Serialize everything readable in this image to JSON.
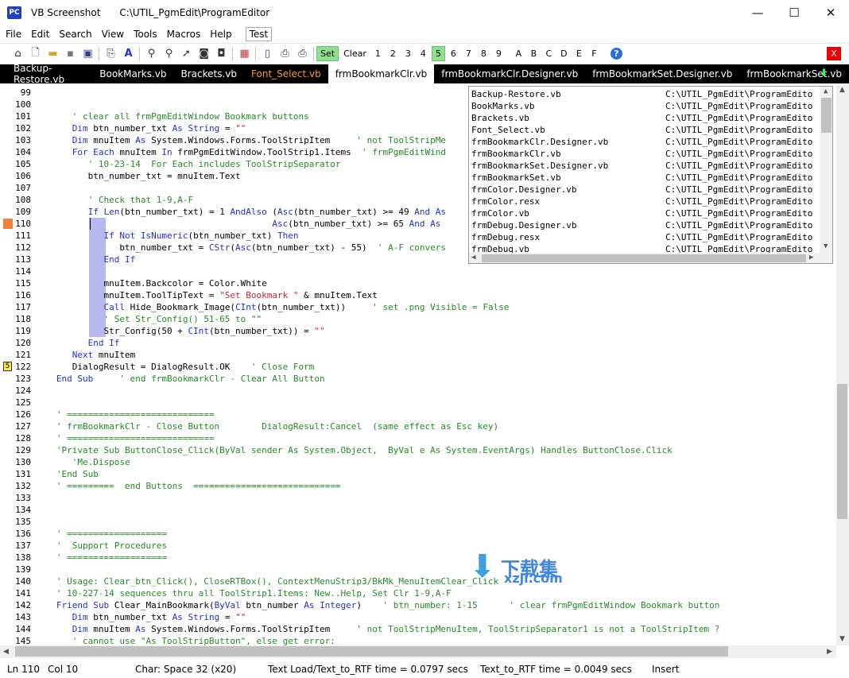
{
  "window": {
    "app_icon_text": "PC",
    "title": "VB Screenshot",
    "path": "C:\\UTIL_PgmEdit\\ProgramEditor",
    "minimize": "—",
    "maximize": "☐",
    "close": "✕"
  },
  "menu": [
    "File",
    "Edit",
    "Search",
    "View",
    "Tools",
    "Macros",
    "Help"
  ],
  "menu_test_box": "Test",
  "toolbar": {
    "icons": [
      "home-icon",
      "new-file-icon",
      "open-folder-icon",
      "save-icon",
      "save-all-icon",
      "copy-icon",
      "font-icon",
      "find-icon",
      "find-next-icon",
      "goto-icon",
      "replace-icon",
      "replace-all-icon",
      "color-grid-icon",
      "book-icon",
      "print-preview-icon",
      "print-icon"
    ],
    "set_label": "Set",
    "clear_label": "Clear",
    "numbers": [
      "1",
      "2",
      "3",
      "4",
      "5",
      "6",
      "7",
      "8",
      "9"
    ],
    "active_number": "5",
    "letters": [
      "A",
      "B",
      "C",
      "D",
      "E",
      "F"
    ],
    "help_icon": "?",
    "close_label": "X"
  },
  "tabs": [
    {
      "label": "Backup-Restore.vb",
      "state": "normal"
    },
    {
      "label": "BookMarks.vb",
      "state": "normal"
    },
    {
      "label": "Brackets.vb",
      "state": "normal"
    },
    {
      "label": "Font_Select.vb",
      "state": "orange"
    },
    {
      "label": "frmBookmarkClr.vb",
      "state": "active"
    },
    {
      "label": "frmBookmarkClr.Designer.vb",
      "state": "normal"
    },
    {
      "label": "frmBookmarkSet.Designer.vb",
      "state": "normal"
    },
    {
      "label": "frmBookmarkSet.vb",
      "state": "normal"
    }
  ],
  "colors": {
    "keyword": "#1c30d8",
    "comment": "#238b23",
    "string": "#c0282f",
    "active_tab_bg": "#ffffff",
    "tabbar_bg": "#000000",
    "set_green": "#8ee08e",
    "bookmark_yellow": "#ffe84a",
    "breakpoint_orange": "#f08040"
  },
  "code_lines": [
    {
      "n": "99",
      "t": ""
    },
    {
      "n": "100",
      "t": ""
    },
    {
      "n": "101",
      "t": "      ' clear all frmPgmEditWindow Bookmark buttons"
    },
    {
      "n": "102",
      "t": "      Dim btn_number_txt As String = \"\""
    },
    {
      "n": "103",
      "t": "      Dim mnuItem As System.Windows.Forms.ToolStripItem     ' not ToolStripMe"
    },
    {
      "n": "104",
      "t": "      For Each mnuItem In frmPgmEditWindow.ToolStrip1.Items  ' frmPgmEditWind"
    },
    {
      "n": "105",
      "t": "         ' 10-23-14  For Each includes ToolStripSeparator"
    },
    {
      "n": "106",
      "t": "         btn_number_txt = mnuItem.Text"
    },
    {
      "n": "107",
      "t": ""
    },
    {
      "n": "108",
      "t": "         ' Check that 1-9,A-F"
    },
    {
      "n": "109",
      "t": "         If Len(btn_number_txt) = 1 AndAlso (Asc(btn_number_txt) >= 49 And As"
    },
    {
      "n": "110",
      "t": "                                            Asc(btn_number_txt) >= 65 And As"
    },
    {
      "n": "111",
      "t": "            If Not IsNumeric(btn_number_txt) Then"
    },
    {
      "n": "112",
      "t": "               btn_number_txt = CStr(Asc(btn_number_txt) - 55)  ' A-F convers"
    },
    {
      "n": "113",
      "t": "            End If"
    },
    {
      "n": "114",
      "t": ""
    },
    {
      "n": "115",
      "t": "            mnuItem.Backcolor = Color.White"
    },
    {
      "n": "116",
      "t": "            mnuItem.ToolTipText = \"Set Bookmark \" & mnuItem.Text"
    },
    {
      "n": "117",
      "t": "            Call Hide_Bookmark_Image(CInt(btn_number_txt))     ' set .png Visible = False"
    },
    {
      "n": "118",
      "t": "            ' Set Str_Config() 51-65 to \"\""
    },
    {
      "n": "119",
      "t": "            Str_Config(50 + CInt(btn_number_txt)) = \"\""
    },
    {
      "n": "120",
      "t": "         End If"
    },
    {
      "n": "121",
      "t": "      Next mnuItem"
    },
    {
      "n": "122",
      "t": "      DialogResult = DialogResult.OK    ' Close Form"
    },
    {
      "n": "123",
      "t": "   End Sub     ' end frmBookmarkClr - Clear All Button"
    },
    {
      "n": "124",
      "t": ""
    },
    {
      "n": "125",
      "t": ""
    },
    {
      "n": "126",
      "t": "   ' ============================"
    },
    {
      "n": "127",
      "t": "   ' frmBookmarkClr - Close Button        DialogResult:Cancel  (same effect as Esc key)"
    },
    {
      "n": "128",
      "t": "   ' ============================"
    },
    {
      "n": "129",
      "t": "   'Private Sub ButtonClose_Click(ByVal sender As System.Object,  ByVal e As System.EventArgs) Handles ButtonClose.Click"
    },
    {
      "n": "130",
      "t": "      'Me.Dispose"
    },
    {
      "n": "131",
      "t": "   'End Sub"
    },
    {
      "n": "132",
      "t": "   ' =========  end Buttons  ============================"
    },
    {
      "n": "133",
      "t": ""
    },
    {
      "n": "134",
      "t": ""
    },
    {
      "n": "135",
      "t": ""
    },
    {
      "n": "136",
      "t": "   ' ==================="
    },
    {
      "n": "137",
      "t": "   '  Support Procedures"
    },
    {
      "n": "138",
      "t": "   ' ==================="
    },
    {
      "n": "139",
      "t": ""
    },
    {
      "n": "140",
      "t": "   ' Usage: Clear_btn_Click(), CloseRTBox(), ContextMenuStrip3/BkMk_MenuItemClear_Click"
    },
    {
      "n": "141",
      "t": "   ' 10-227-14 sequences thru all ToolStrip1.Items: New..Help, Set Clr 1-9,A-F"
    },
    {
      "n": "142",
      "t": "   Friend Sub Clear_MainBookmark(ByVal btn_number As Integer)    ' btn_number: 1-15      ' clear frmPgmEditWindow Bookmark button"
    },
    {
      "n": "143",
      "t": "      Dim btn_number_txt As String = \"\""
    },
    {
      "n": "144",
      "t": "      Dim mnuItem As System.Windows.Forms.ToolStripItem     ' not ToolStripMenuItem, ToolStripSeparator1 is not a ToolStripItem ?"
    },
    {
      "n": "145",
      "t": "      ' cannot use \"As ToolStripButton\", else get error:"
    }
  ],
  "bookmark_marker_label": "5",
  "file_popup": [
    {
      "file": "Backup-Restore.vb",
      "path": "C:\\UTIL_PgmEdit\\ProgramEdito"
    },
    {
      "file": "BookMarks.vb",
      "path": "C:\\UTIL_PgmEdit\\ProgramEdito"
    },
    {
      "file": "Brackets.vb",
      "path": "C:\\UTIL_PgmEdit\\ProgramEdito"
    },
    {
      "file": "Font_Select.vb",
      "path": "C:\\UTIL_PgmEdit\\ProgramEdito"
    },
    {
      "file": "frmBookmarkClr.Designer.vb",
      "path": "C:\\UTIL_PgmEdit\\ProgramEdito"
    },
    {
      "file": "frmBookmarkClr.vb",
      "path": "C:\\UTIL_PgmEdit\\ProgramEdito"
    },
    {
      "file": "frmBookmarkSet.Designer.vb",
      "path": "C:\\UTIL_PgmEdit\\ProgramEdito"
    },
    {
      "file": "frmBookmarkSet.vb",
      "path": "C:\\UTIL_PgmEdit\\ProgramEdito"
    },
    {
      "file": "frmColor.Designer.vb",
      "path": "C:\\UTIL_PgmEdit\\ProgramEdito"
    },
    {
      "file": "frmColor.resx",
      "path": "C:\\UTIL_PgmEdit\\ProgramEdito"
    },
    {
      "file": "frmColor.vb",
      "path": "C:\\UTIL_PgmEdit\\ProgramEdito"
    },
    {
      "file": "frmDebug.Designer.vb",
      "path": "C:\\UTIL_PgmEdit\\ProgramEdito"
    },
    {
      "file": "frmDebug.resx",
      "path": "C:\\UTIL_PgmEdit\\ProgramEdito"
    },
    {
      "file": "frmDebug.vb",
      "path": "C:\\UTIL_PgmEdit\\ProgramEdito"
    }
  ],
  "status": {
    "ln": "Ln 110",
    "col": "Col 10",
    "char": "Char: Space 32 (x20)",
    "load_time": "Text Load/Text_to_RTF time = 0.0797 secs",
    "rtf_time": "Text_to_RTF time = 0.0049 secs",
    "mode": "Insert"
  },
  "watermark": {
    "text": "下载集",
    "sub": "xzji.com"
  }
}
